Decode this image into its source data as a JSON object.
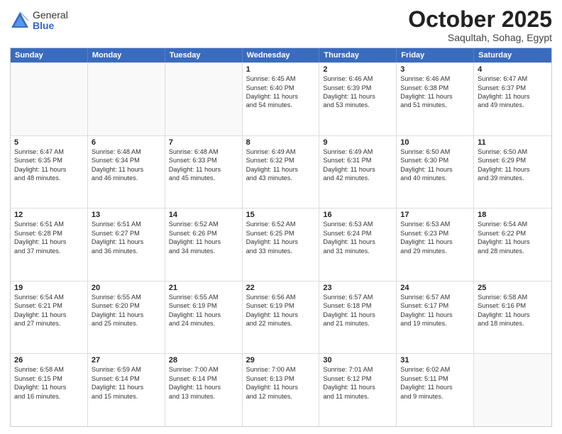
{
  "logo": {
    "general": "General",
    "blue": "Blue"
  },
  "header": {
    "month": "October 2025",
    "location": "Saqultah, Sohag, Egypt"
  },
  "weekdays": [
    "Sunday",
    "Monday",
    "Tuesday",
    "Wednesday",
    "Thursday",
    "Friday",
    "Saturday"
  ],
  "rows": [
    [
      {
        "day": "",
        "lines": [],
        "empty": true
      },
      {
        "day": "",
        "lines": [],
        "empty": true
      },
      {
        "day": "",
        "lines": [],
        "empty": true
      },
      {
        "day": "1",
        "lines": [
          "Sunrise: 6:45 AM",
          "Sunset: 6:40 PM",
          "Daylight: 11 hours",
          "and 54 minutes."
        ]
      },
      {
        "day": "2",
        "lines": [
          "Sunrise: 6:46 AM",
          "Sunset: 6:39 PM",
          "Daylight: 11 hours",
          "and 53 minutes."
        ]
      },
      {
        "day": "3",
        "lines": [
          "Sunrise: 6:46 AM",
          "Sunset: 6:38 PM",
          "Daylight: 11 hours",
          "and 51 minutes."
        ]
      },
      {
        "day": "4",
        "lines": [
          "Sunrise: 6:47 AM",
          "Sunset: 6:37 PM",
          "Daylight: 11 hours",
          "and 49 minutes."
        ]
      }
    ],
    [
      {
        "day": "5",
        "lines": [
          "Sunrise: 6:47 AM",
          "Sunset: 6:35 PM",
          "Daylight: 11 hours",
          "and 48 minutes."
        ]
      },
      {
        "day": "6",
        "lines": [
          "Sunrise: 6:48 AM",
          "Sunset: 6:34 PM",
          "Daylight: 11 hours",
          "and 46 minutes."
        ]
      },
      {
        "day": "7",
        "lines": [
          "Sunrise: 6:48 AM",
          "Sunset: 6:33 PM",
          "Daylight: 11 hours",
          "and 45 minutes."
        ]
      },
      {
        "day": "8",
        "lines": [
          "Sunrise: 6:49 AM",
          "Sunset: 6:32 PM",
          "Daylight: 11 hours",
          "and 43 minutes."
        ]
      },
      {
        "day": "9",
        "lines": [
          "Sunrise: 6:49 AM",
          "Sunset: 6:31 PM",
          "Daylight: 11 hours",
          "and 42 minutes."
        ]
      },
      {
        "day": "10",
        "lines": [
          "Sunrise: 6:50 AM",
          "Sunset: 6:30 PM",
          "Daylight: 11 hours",
          "and 40 minutes."
        ]
      },
      {
        "day": "11",
        "lines": [
          "Sunrise: 6:50 AM",
          "Sunset: 6:29 PM",
          "Daylight: 11 hours",
          "and 39 minutes."
        ]
      }
    ],
    [
      {
        "day": "12",
        "lines": [
          "Sunrise: 6:51 AM",
          "Sunset: 6:28 PM",
          "Daylight: 11 hours",
          "and 37 minutes."
        ]
      },
      {
        "day": "13",
        "lines": [
          "Sunrise: 6:51 AM",
          "Sunset: 6:27 PM",
          "Daylight: 11 hours",
          "and 36 minutes."
        ]
      },
      {
        "day": "14",
        "lines": [
          "Sunrise: 6:52 AM",
          "Sunset: 6:26 PM",
          "Daylight: 11 hours",
          "and 34 minutes."
        ]
      },
      {
        "day": "15",
        "lines": [
          "Sunrise: 6:52 AM",
          "Sunset: 6:25 PM",
          "Daylight: 11 hours",
          "and 33 minutes."
        ]
      },
      {
        "day": "16",
        "lines": [
          "Sunrise: 6:53 AM",
          "Sunset: 6:24 PM",
          "Daylight: 11 hours",
          "and 31 minutes."
        ]
      },
      {
        "day": "17",
        "lines": [
          "Sunrise: 6:53 AM",
          "Sunset: 6:23 PM",
          "Daylight: 11 hours",
          "and 29 minutes."
        ]
      },
      {
        "day": "18",
        "lines": [
          "Sunrise: 6:54 AM",
          "Sunset: 6:22 PM",
          "Daylight: 11 hours",
          "and 28 minutes."
        ]
      }
    ],
    [
      {
        "day": "19",
        "lines": [
          "Sunrise: 6:54 AM",
          "Sunset: 6:21 PM",
          "Daylight: 11 hours",
          "and 27 minutes."
        ]
      },
      {
        "day": "20",
        "lines": [
          "Sunrise: 6:55 AM",
          "Sunset: 6:20 PM",
          "Daylight: 11 hours",
          "and 25 minutes."
        ]
      },
      {
        "day": "21",
        "lines": [
          "Sunrise: 6:55 AM",
          "Sunset: 6:19 PM",
          "Daylight: 11 hours",
          "and 24 minutes."
        ]
      },
      {
        "day": "22",
        "lines": [
          "Sunrise: 6:56 AM",
          "Sunset: 6:19 PM",
          "Daylight: 11 hours",
          "and 22 minutes."
        ]
      },
      {
        "day": "23",
        "lines": [
          "Sunrise: 6:57 AM",
          "Sunset: 6:18 PM",
          "Daylight: 11 hours",
          "and 21 minutes."
        ]
      },
      {
        "day": "24",
        "lines": [
          "Sunrise: 6:57 AM",
          "Sunset: 6:17 PM",
          "Daylight: 11 hours",
          "and 19 minutes."
        ]
      },
      {
        "day": "25",
        "lines": [
          "Sunrise: 6:58 AM",
          "Sunset: 6:16 PM",
          "Daylight: 11 hours",
          "and 18 minutes."
        ]
      }
    ],
    [
      {
        "day": "26",
        "lines": [
          "Sunrise: 6:58 AM",
          "Sunset: 6:15 PM",
          "Daylight: 11 hours",
          "and 16 minutes."
        ]
      },
      {
        "day": "27",
        "lines": [
          "Sunrise: 6:59 AM",
          "Sunset: 6:14 PM",
          "Daylight: 11 hours",
          "and 15 minutes."
        ]
      },
      {
        "day": "28",
        "lines": [
          "Sunrise: 7:00 AM",
          "Sunset: 6:14 PM",
          "Daylight: 11 hours",
          "and 13 minutes."
        ]
      },
      {
        "day": "29",
        "lines": [
          "Sunrise: 7:00 AM",
          "Sunset: 6:13 PM",
          "Daylight: 11 hours",
          "and 12 minutes."
        ]
      },
      {
        "day": "30",
        "lines": [
          "Sunrise: 7:01 AM",
          "Sunset: 6:12 PM",
          "Daylight: 11 hours",
          "and 11 minutes."
        ]
      },
      {
        "day": "31",
        "lines": [
          "Sunrise: 6:02 AM",
          "Sunset: 5:11 PM",
          "Daylight: 11 hours",
          "and 9 minutes."
        ]
      },
      {
        "day": "",
        "lines": [],
        "empty": true
      }
    ]
  ]
}
